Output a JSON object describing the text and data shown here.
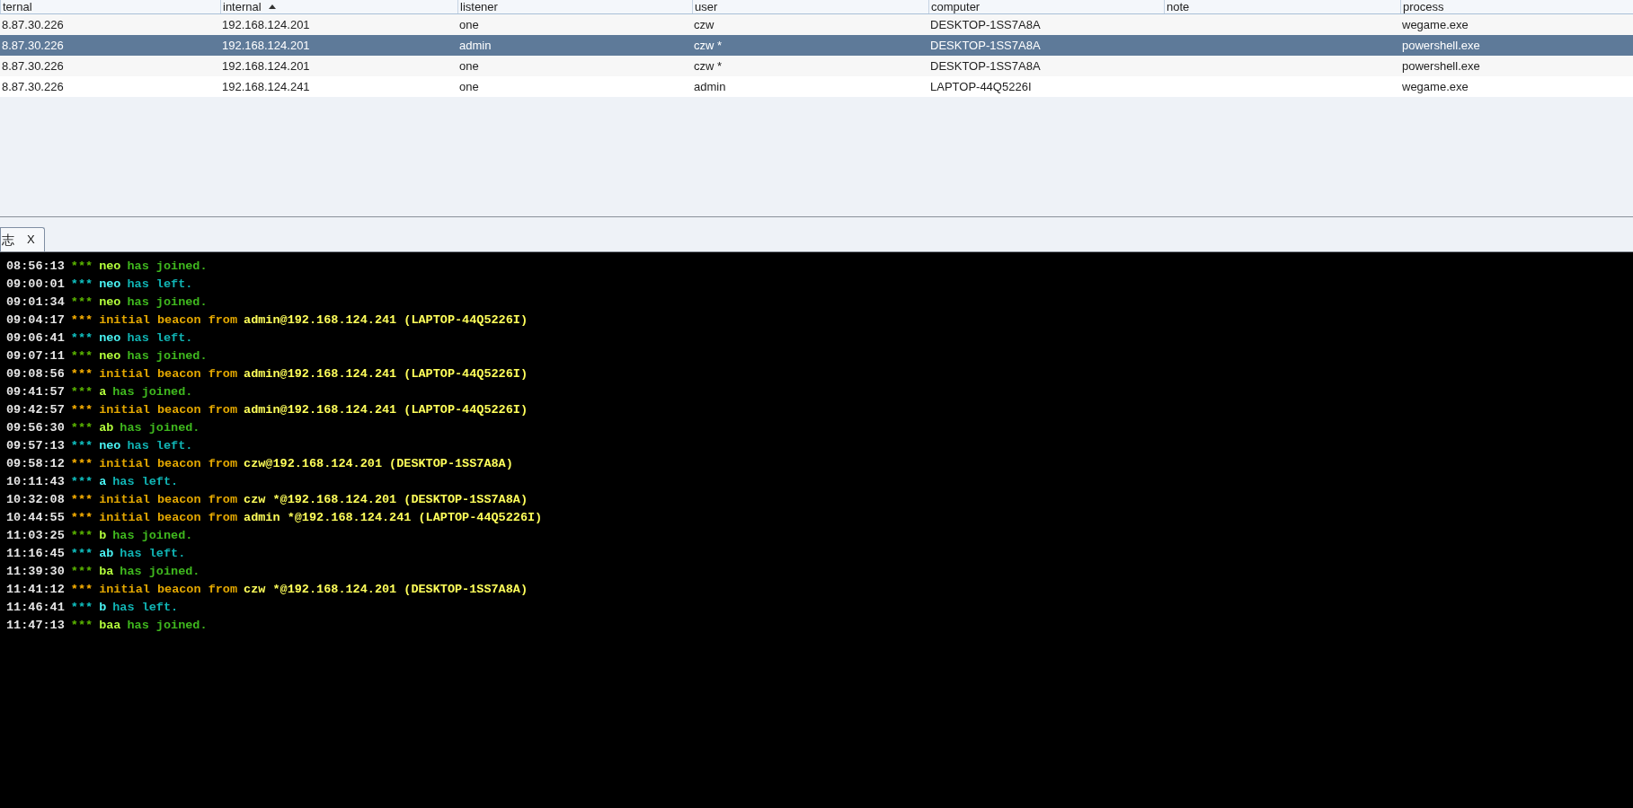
{
  "table": {
    "columns": [
      {
        "label": "ternal",
        "sorted": false
      },
      {
        "label": "internal",
        "sorted": true
      },
      {
        "label": "listener",
        "sorted": false
      },
      {
        "label": "user",
        "sorted": false
      },
      {
        "label": "computer",
        "sorted": false
      },
      {
        "label": "note",
        "sorted": false
      },
      {
        "label": "process",
        "sorted": false
      }
    ],
    "rows": [
      {
        "selected": false,
        "cells": [
          "8.87.30.226",
          "192.168.124.201",
          "one",
          "czw",
          "DESKTOP-1SS7A8A",
          "",
          "wegame.exe"
        ]
      },
      {
        "selected": true,
        "cells": [
          "8.87.30.226",
          "192.168.124.201",
          "admin",
          "czw *",
          "DESKTOP-1SS7A8A",
          "",
          "powershell.exe"
        ]
      },
      {
        "selected": false,
        "cells": [
          "8.87.30.226",
          "192.168.124.201",
          "one",
          "czw *",
          "DESKTOP-1SS7A8A",
          "",
          "powershell.exe"
        ]
      },
      {
        "selected": false,
        "cells": [
          "8.87.30.226",
          "192.168.124.241",
          "one",
          "admin",
          "LAPTOP-44Q5226I",
          "",
          "wegame.exe"
        ]
      }
    ]
  },
  "tabs": [
    {
      "label": "志",
      "close": "X",
      "selected": true
    }
  ],
  "log": [
    {
      "time": "08:56:13",
      "kind": "join",
      "stars": "***",
      "who": "neo",
      "text": "has joined."
    },
    {
      "time": "09:00:01",
      "kind": "left",
      "stars": "***",
      "who": "neo",
      "text": "has left."
    },
    {
      "time": "09:01:34",
      "kind": "join",
      "stars": "***",
      "who": "neo",
      "text": "has joined."
    },
    {
      "time": "09:04:17",
      "kind": "beacon",
      "stars": "***",
      "who": "admin@192.168.124.241 (LAPTOP-44Q5226I)",
      "text": "initial beacon from"
    },
    {
      "time": "09:06:41",
      "kind": "left",
      "stars": "***",
      "who": "neo",
      "text": "has left."
    },
    {
      "time": "09:07:11",
      "kind": "join",
      "stars": "***",
      "who": "neo",
      "text": "has joined."
    },
    {
      "time": "09:08:56",
      "kind": "beacon",
      "stars": "***",
      "who": "admin@192.168.124.241 (LAPTOP-44Q5226I)",
      "text": "initial beacon from"
    },
    {
      "time": "09:41:57",
      "kind": "join",
      "stars": "***",
      "who": "a",
      "text": "has joined."
    },
    {
      "time": "09:42:57",
      "kind": "beacon",
      "stars": "***",
      "who": "admin@192.168.124.241 (LAPTOP-44Q5226I)",
      "text": "initial beacon from"
    },
    {
      "time": "09:56:30",
      "kind": "join",
      "stars": "***",
      "who": "ab",
      "text": "has joined."
    },
    {
      "time": "09:57:13",
      "kind": "left",
      "stars": "***",
      "who": "neo",
      "text": "has left."
    },
    {
      "time": "09:58:12",
      "kind": "beacon",
      "stars": "***",
      "who": "czw@192.168.124.201 (DESKTOP-1SS7A8A)",
      "text": "initial beacon from"
    },
    {
      "time": "10:11:43",
      "kind": "left",
      "stars": "***",
      "who": "a",
      "text": "has left."
    },
    {
      "time": "10:32:08",
      "kind": "beacon",
      "stars": "***",
      "who": "czw *@192.168.124.201 (DESKTOP-1SS7A8A)",
      "text": "initial beacon from"
    },
    {
      "time": "10:44:55",
      "kind": "beacon",
      "stars": "***",
      "who": "admin *@192.168.124.241 (LAPTOP-44Q5226I)",
      "text": "initial beacon from"
    },
    {
      "time": "11:03:25",
      "kind": "join",
      "stars": "***",
      "who": "b",
      "text": "has joined."
    },
    {
      "time": "11:16:45",
      "kind": "left",
      "stars": "***",
      "who": "ab",
      "text": "has left."
    },
    {
      "time": "11:39:30",
      "kind": "join",
      "stars": "***",
      "who": "ba",
      "text": "has joined."
    },
    {
      "time": "11:41:12",
      "kind": "beacon",
      "stars": "***",
      "who": "czw *@192.168.124.201 (DESKTOP-1SS7A8A)",
      "text": "initial beacon from"
    },
    {
      "time": "11:46:41",
      "kind": "left",
      "stars": "***",
      "who": "b",
      "text": "has left."
    },
    {
      "time": "11:47:13",
      "kind": "join",
      "stars": "***",
      "who": "baa",
      "text": "has joined."
    }
  ]
}
